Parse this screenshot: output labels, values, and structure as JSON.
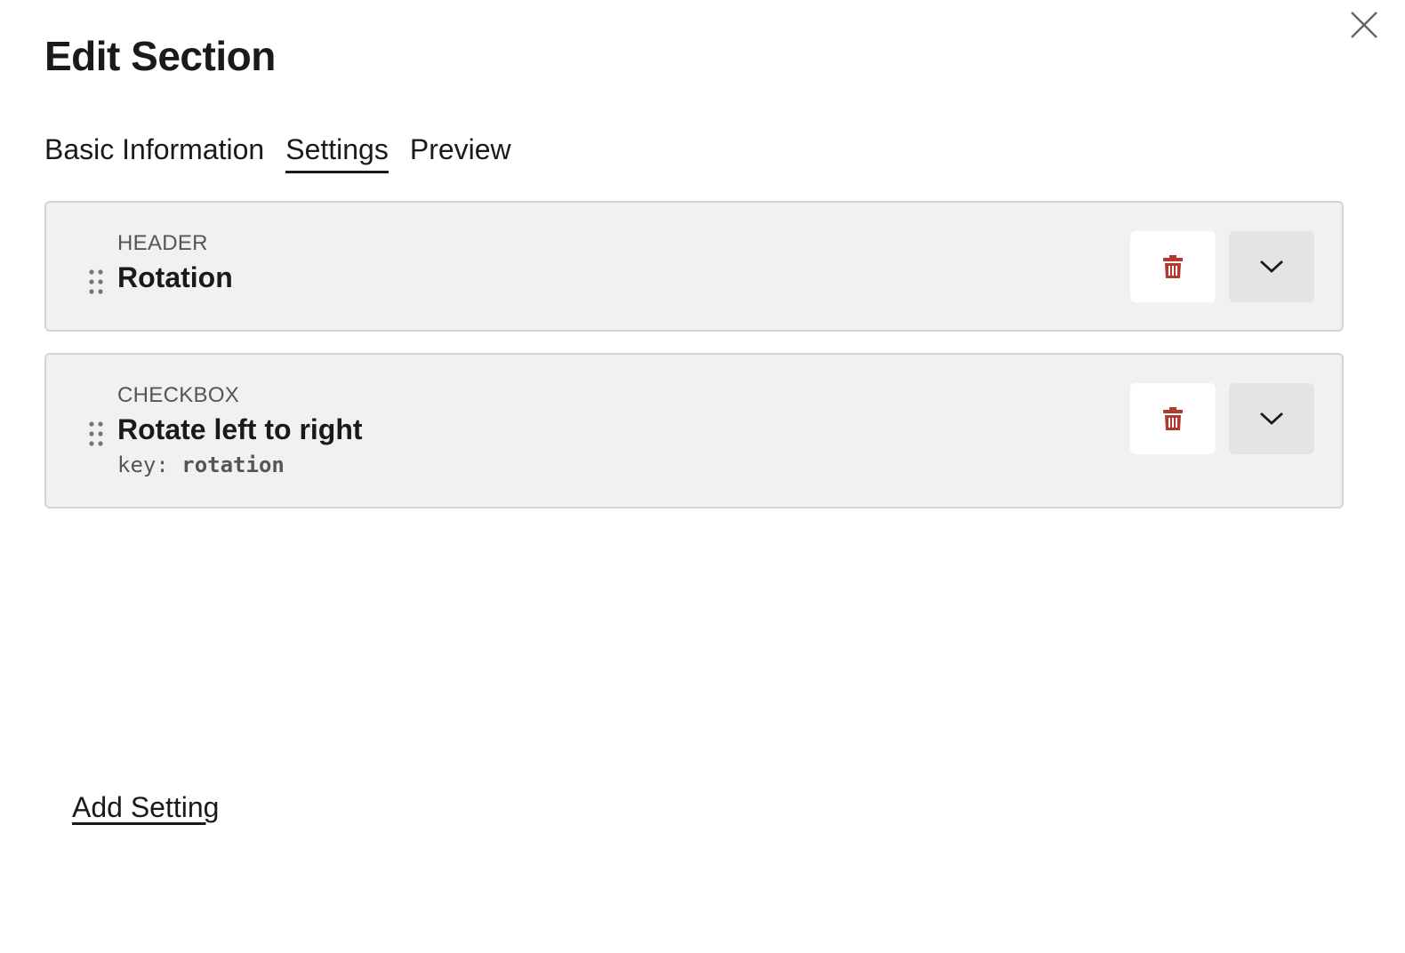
{
  "dialog": {
    "title": "Edit Section",
    "close_icon": "close-icon"
  },
  "tabs": [
    {
      "label": "Basic Information",
      "active": false
    },
    {
      "label": "Settings",
      "active": true
    },
    {
      "label": "Preview",
      "active": false
    }
  ],
  "settings": [
    {
      "type": "HEADER",
      "title": "Rotation"
    },
    {
      "type": "CHECKBOX",
      "title": "Rotate left to right",
      "key_label": "key:",
      "key_value": "rotation"
    }
  ],
  "actions": {
    "add_setting_label": "Add Setting"
  },
  "colors": {
    "delete_icon": "#b03a2e",
    "card_background": "#f1f1f1",
    "card_border": "#d4d4d4",
    "expand_button_background": "#e4e4e4"
  },
  "icons": {
    "drag": "drag-handle-icon",
    "delete": "trash-icon",
    "expand": "chevron-down-icon"
  }
}
